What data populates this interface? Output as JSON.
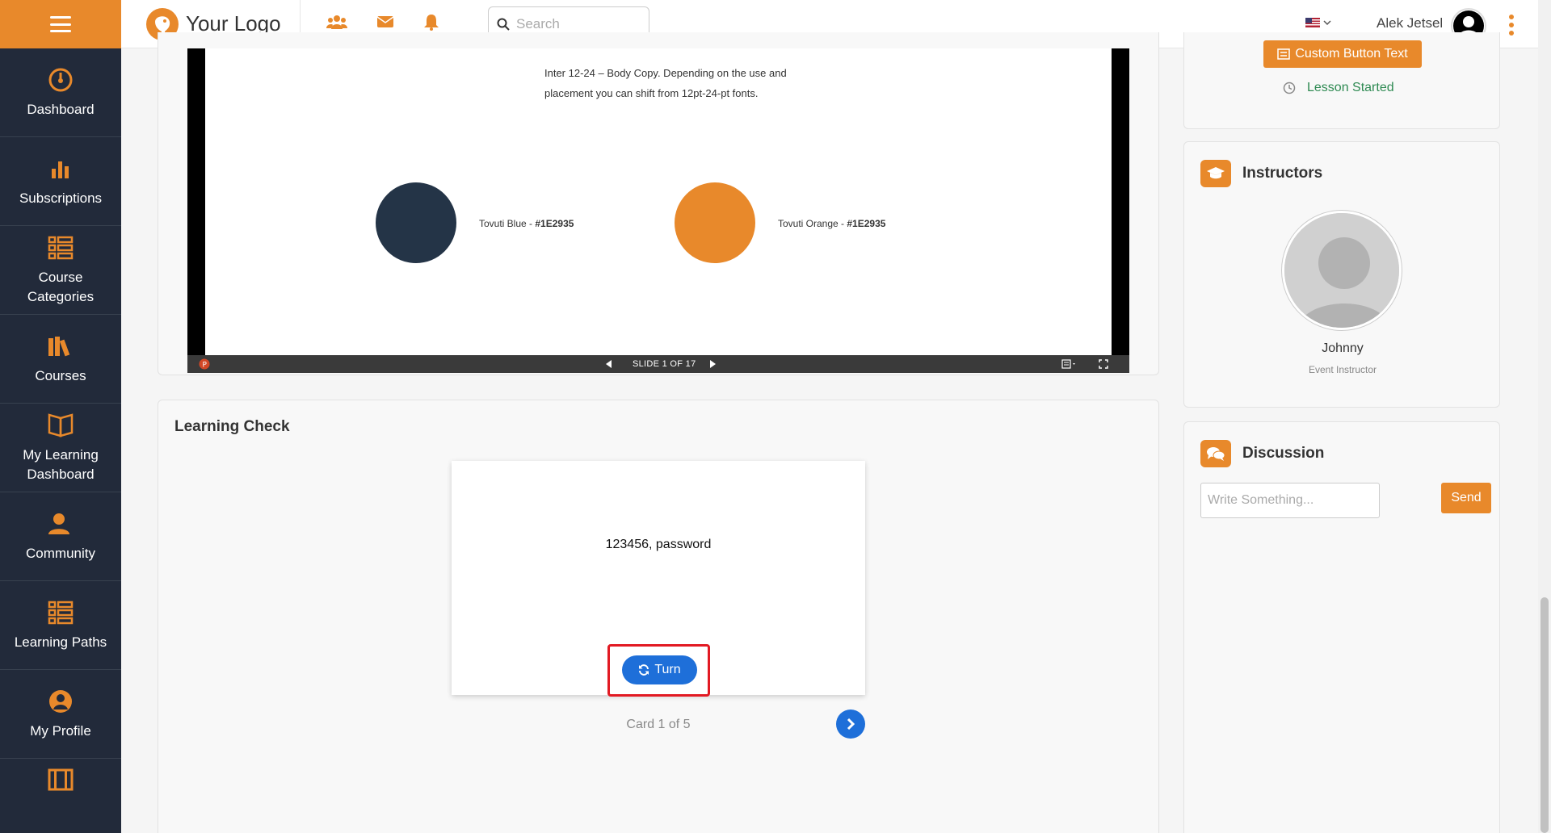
{
  "brand": {
    "name": "Your Logo"
  },
  "header": {
    "search_placeholder": "Search",
    "user_name": "Alek Jetsel",
    "icons": [
      "users-icon",
      "envelope-icon",
      "bell-icon",
      "search-icon",
      "us-flag-icon",
      "user-circle-icon",
      "kebab-menu-icon"
    ]
  },
  "sidebar": {
    "items": [
      {
        "label": "Dashboard",
        "icon": "speedometer-icon"
      },
      {
        "label": "Subscriptions",
        "icon": "bar-chart-icon"
      },
      {
        "label": "Course Categories",
        "icon": "list-icon"
      },
      {
        "label": "Courses",
        "icon": "books-icon"
      },
      {
        "label": "My Learning Dashboard",
        "icon": "open-book-icon"
      },
      {
        "label": "Community",
        "icon": "community-icon"
      },
      {
        "label": "Learning Paths",
        "icon": "list-icon"
      },
      {
        "label": "My Profile",
        "icon": "user-icon"
      }
    ]
  },
  "slide": {
    "body_text": "Inter 12-24 – Body Copy. Depending on the use and placement you can shift from 12pt-24-pt fonts.",
    "swatches": [
      {
        "label": "Tovuti Blue - ",
        "code": "#1E2935",
        "color": "#243447"
      },
      {
        "label": "Tovuti Orange - ",
        "code": "#1E2935",
        "color": "#e8892b"
      }
    ],
    "counter": "SLIDE 1 OF 17"
  },
  "learning_check": {
    "title": "Learning Check",
    "card_text": "123456, password",
    "turn_label": "Turn",
    "card_count": "Card 1 of 5"
  },
  "lesson": {
    "custom_button": "Custom Button Text",
    "status": "Lesson Started"
  },
  "instructors": {
    "title": "Instructors",
    "name": "Johnny",
    "role": "Event Instructor"
  },
  "discussion": {
    "title": "Discussion",
    "placeholder": "Write Something...",
    "send_label": "Send"
  },
  "colors": {
    "accent": "#e8892b",
    "sidebar": "#222a3a",
    "primary_button": "#1e6fd9",
    "highlight": "#e21a23",
    "status_green": "#2e8a52"
  }
}
